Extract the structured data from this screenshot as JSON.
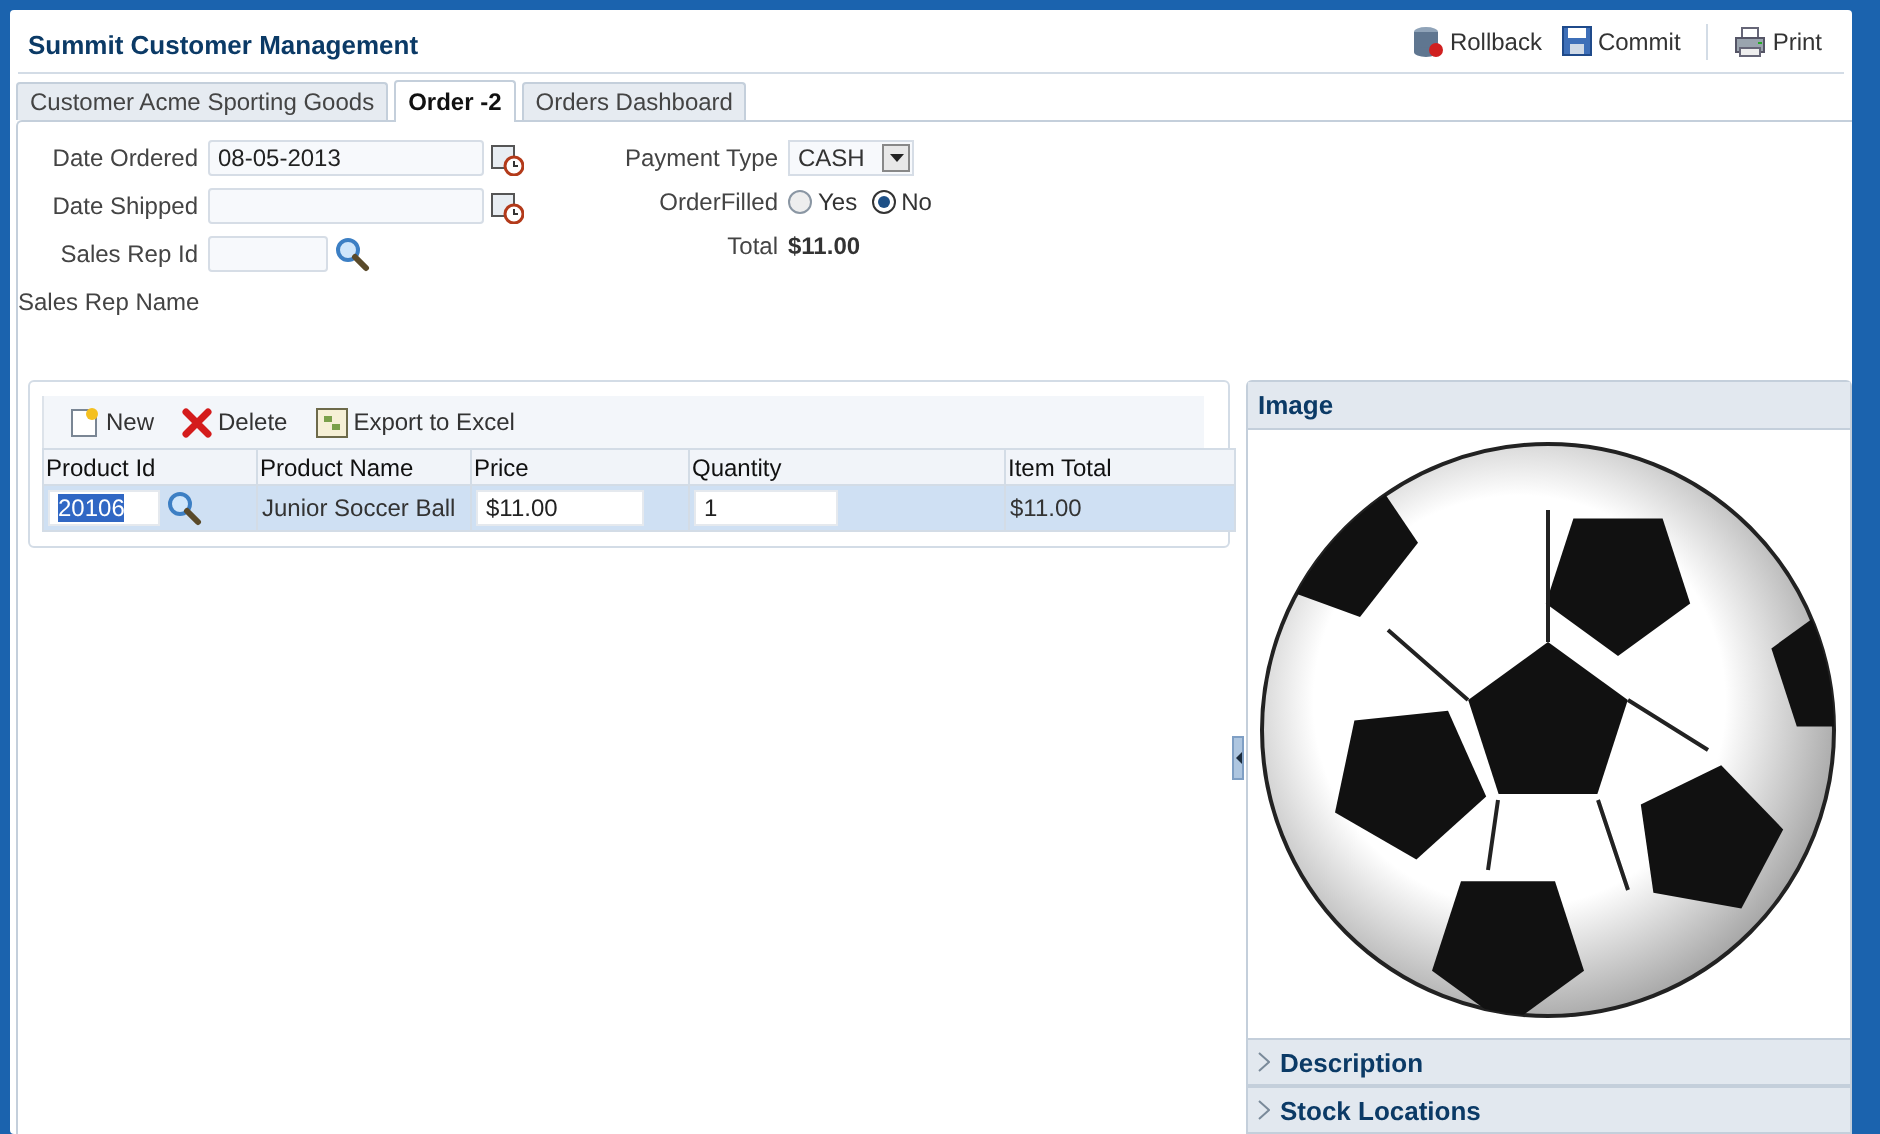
{
  "app": {
    "title": "Summit Customer Management",
    "actions": [
      {
        "label": "Rollback",
        "kind": "rollback"
      },
      {
        "label": "Commit",
        "kind": "commit"
      },
      {
        "label": "Print",
        "kind": "print"
      }
    ]
  },
  "tabs": [
    {
      "label": "Customer Acme Sporting Goods",
      "selected": false
    },
    {
      "label": "Order -2",
      "selected": true
    },
    {
      "label": "Orders Dashboard",
      "selected": false
    }
  ],
  "form": {
    "left": [
      {
        "label": "Date Ordered",
        "kind": "date",
        "value": "08-05-2013"
      },
      {
        "label": "Date Shipped",
        "kind": "date"
      },
      {
        "label": "Sales Rep Id",
        "kind": "lookup"
      },
      {
        "label": "Sales Rep Name",
        "kind": "text"
      }
    ],
    "payment_type": {
      "label": "Payment Type",
      "value": "CASH"
    },
    "order_filled": {
      "label": "OrderFilled",
      "options": [
        {
          "label": "Yes",
          "selected": false
        },
        {
          "label": "No",
          "selected": true
        }
      ]
    },
    "total": {
      "label": "Total",
      "value": "$11.00"
    }
  },
  "toolbar": [
    {
      "label": "New",
      "kind": "new"
    },
    {
      "label": "Delete",
      "kind": "delete"
    },
    {
      "label": "Export to Excel",
      "kind": "excel"
    }
  ],
  "table": {
    "columns": [
      "Product Id",
      "Product Name",
      "Price",
      "Quantity",
      "Item Total"
    ],
    "rows": [
      {
        "product_id": "20106",
        "product_name": "Junior Soccer Ball",
        "price": "$11.00",
        "quantity": "1",
        "item_total": "$11.00",
        "selected": true
      }
    ]
  },
  "side_panel": {
    "sections": [
      {
        "title": "Image",
        "expanded": true,
        "kind": "picture"
      },
      {
        "title": "Description",
        "expanded": false
      },
      {
        "title": "Stock Locations",
        "expanded": false
      }
    ]
  }
}
